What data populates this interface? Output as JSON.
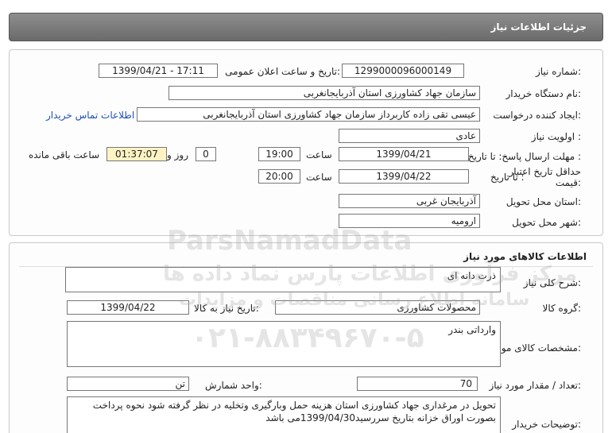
{
  "header": {
    "title": "جزئیات اطلاعات نیاز"
  },
  "need_info": {
    "need_number_label": "شماره نیاز:",
    "need_number": "1299000096000149",
    "announce_label": "تاریخ و ساعت اعلان عمومی:",
    "announce_value": "1399/04/21 - 17:11",
    "buyer_org_label": "نام دستگاه خریدار:",
    "buyer_org": "سازمان جهاد کشاورزی استان آذربایجانغربی",
    "requester_label": "ایجاد کننده درخواست:",
    "requester": "عیسی تقی زاده کاربرداز سازمان جهاد کشاورزی استان آذربایجانغربی",
    "contact_link": "اطلاعات تماس خریدار",
    "priority_label": "اولویت نیاز :",
    "priority": "عادی",
    "deadline_label": "مهلت ارسال پاسخ:  تا تاریخ :",
    "deadline_date": "1399/04/21",
    "time_label": "ساعت",
    "deadline_time": "19:00",
    "days_value": "0",
    "days_label": "روز و",
    "remaining_time": "01:37:07",
    "remaining_label": "ساعت باقی مانده",
    "validity_label": "حداقل تاریخ اعتبار قیمت:",
    "validity_to_label": "تا تاریخ :",
    "validity_date": "1399/04/22",
    "validity_time_label": "ساعت",
    "validity_time": "20:00",
    "province_label": "استان محل تحویل:",
    "province": "آذربایجان غربی",
    "city_label": "شهر محل تحویل:",
    "city": "ارومیه"
  },
  "goods_info": {
    "section_title": "اطلاعات کالاهای مورد نیاز",
    "summary_label": "شرح کلی نیاز:",
    "summary": "ذرت دانه ای",
    "group_label": "گروه کالا:",
    "group": "محصولات کشاورزی",
    "need_date_label": "تاریخ نیاز به کالا:",
    "need_date": "1399/04/22",
    "specs_label": "مشخصات کالای مورد نیاز:",
    "specs": "وارداتی بندر",
    "quantity_label": "تعداد / مقدار مورد نیاز:",
    "quantity": "70",
    "unit_label": "واحد شمارش:",
    "unit": "تن",
    "buyer_notes_label": "توضیحات خریدار:",
    "buyer_notes": "تحویل در مرغداری جهاد کشاورزی استان هزینه حمل وبارگیری وتخلیه در نظر گرفته شود نحوه پرداخت بصورت اوراق خزانه بتاریخ سررسید1399/04/30می باشد"
  },
  "watermark": {
    "brand": "ParsNamadData",
    "tagline": "مرکز فرآوری اطلاعات پارس نماد داده ها",
    "tagline2": "سامانه اطلاع رسانی مناقصات و مزایدات",
    "phone": "۰۲۱-۸۸۳۴۹۶۷۰-۵"
  },
  "colors": {
    "header_bg": "#7a7a7a",
    "link": "#1f4fb5",
    "highlight": "#fff3c4"
  }
}
